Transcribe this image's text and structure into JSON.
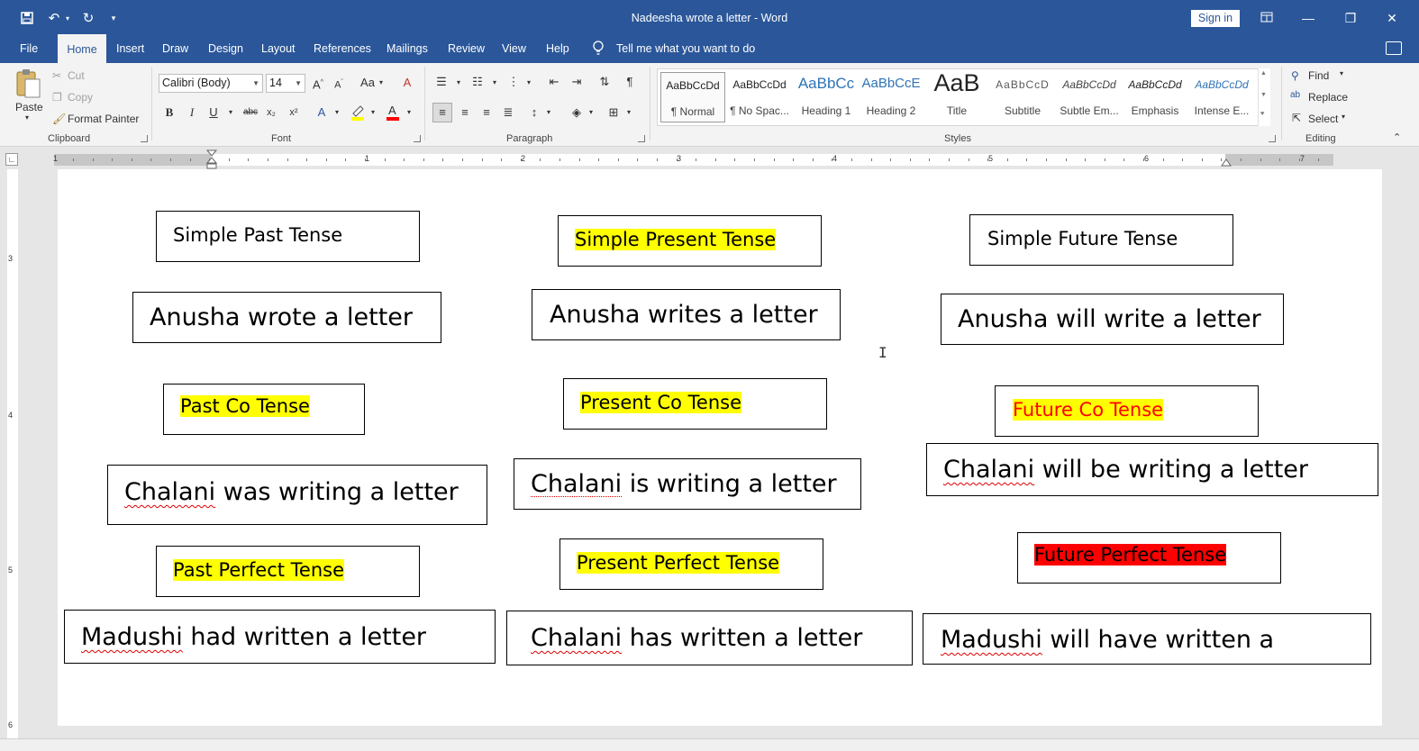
{
  "window": {
    "doc_title": "Nadeesha wrote a letter  -  Word",
    "sign_in": "Sign in"
  },
  "tabs": [
    {
      "label": "File"
    },
    {
      "label": "Home"
    },
    {
      "label": "Insert"
    },
    {
      "label": "Draw"
    },
    {
      "label": "Design"
    },
    {
      "label": "Layout"
    },
    {
      "label": "References"
    },
    {
      "label": "Mailings"
    },
    {
      "label": "Review"
    },
    {
      "label": "View"
    },
    {
      "label": "Help"
    }
  ],
  "tell_me": "Tell me what you want to do",
  "clipboard": {
    "paste": "Paste",
    "cut": "Cut",
    "copy": "Copy",
    "format_painter": "Format Painter",
    "group": "Clipboard"
  },
  "font": {
    "name": "Calibri (Body)",
    "size": "14",
    "group": "Font",
    "change_case": "Aa"
  },
  "paragraph": {
    "group": "Paragraph"
  },
  "styles": {
    "group": "Styles",
    "items": [
      {
        "preview": "AaBbCcDd",
        "name": "¶ Normal"
      },
      {
        "preview": "AaBbCcDd",
        "name": "¶ No Spac..."
      },
      {
        "preview": "AaBbCc",
        "name": "Heading 1"
      },
      {
        "preview": "AaBbCcE",
        "name": "Heading 2"
      },
      {
        "preview": "AaB",
        "name": "Title"
      },
      {
        "preview": "AaBbCcD",
        "name": "Subtitle"
      },
      {
        "preview": "AaBbCcDd",
        "name": "Subtle Em..."
      },
      {
        "preview": "AaBbCcDd",
        "name": "Emphasis"
      },
      {
        "preview": "AaBbCcDd",
        "name": "Intense E..."
      }
    ]
  },
  "editing": {
    "find": "Find",
    "replace": "Replace",
    "select": "Select",
    "group": "Editing"
  },
  "ruler": {
    "numbers": [
      "1",
      "1",
      "2",
      "3",
      "4",
      "5",
      "6",
      "7"
    ]
  },
  "vruler": {
    "numbers": [
      "3",
      "4",
      "5",
      "6"
    ]
  },
  "document": {
    "boxes": [
      {
        "text": "Simple Past Tense"
      },
      {
        "text": "Simple Present Tense"
      },
      {
        "text": "Simple Future Tense"
      },
      {
        "text_a": "Anusha wrote a letter"
      },
      {
        "text": "Anusha writes a letter"
      },
      {
        "text": "Anusha will write a letter"
      },
      {
        "text": "Past Co Tense"
      },
      {
        "text": "Present Co Tense"
      },
      {
        "text": "Future Co Tense"
      },
      {
        "name": "Chalani",
        "rest": " was writing a letter"
      },
      {
        "name": "Chalani",
        "rest": " is writing a letter"
      },
      {
        "name": "Chalani",
        "rest": " will be writing a letter"
      },
      {
        "text": "Past Perfect Tense"
      },
      {
        "text": "Present Perfect Tense"
      },
      {
        "text": "Future Perfect Tense"
      },
      {
        "name": "Madushi",
        "rest": " had written a letter"
      },
      {
        "name": "Chalani",
        "rest": " has written a letter"
      },
      {
        "name": "Madushi",
        "rest": " will have written a"
      }
    ]
  },
  "colors": {
    "titlebar": "#2b579a",
    "highlight_yellow": "#ffff00",
    "highlight_red": "#ff0000",
    "font_red": "#ff0000"
  }
}
